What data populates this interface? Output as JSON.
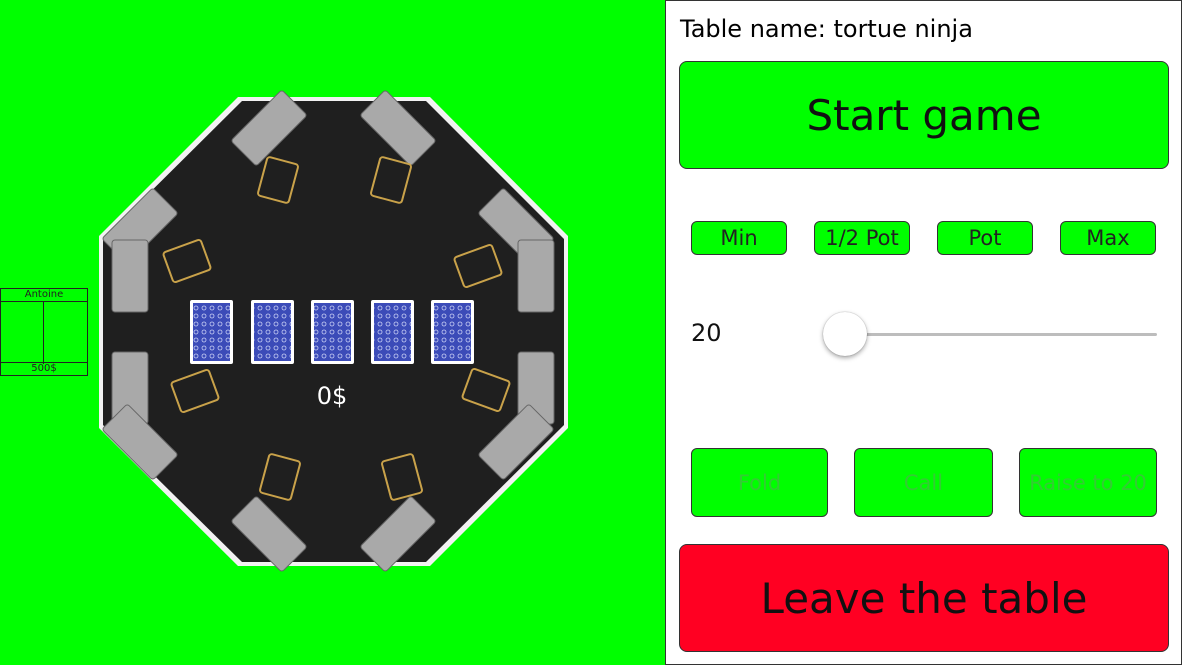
{
  "table": {
    "pot": "0$",
    "community_cards": [
      "card-back",
      "card-back",
      "card-back",
      "card-back",
      "card-back"
    ],
    "felt_color": "#1f1f1f"
  },
  "seat": {
    "player_name": "Antoine",
    "stack": "500$"
  },
  "panel": {
    "table_name": "Table name: tortue ninja",
    "start_label": "Start game",
    "bet_presets": [
      "Min",
      "1/2 Pot",
      "Pot",
      "Max"
    ],
    "bet_value": "20",
    "bet_fraction": 0.0,
    "fold_label": "Fold",
    "call_label": "Call",
    "raise_label": "Raise to 20",
    "leave_label": "Leave the table"
  },
  "colors": {
    "background": "#00ff00",
    "button_green": "#00ff00",
    "leave_red": "#ff0022",
    "disabled_text": "#33cc33"
  }
}
